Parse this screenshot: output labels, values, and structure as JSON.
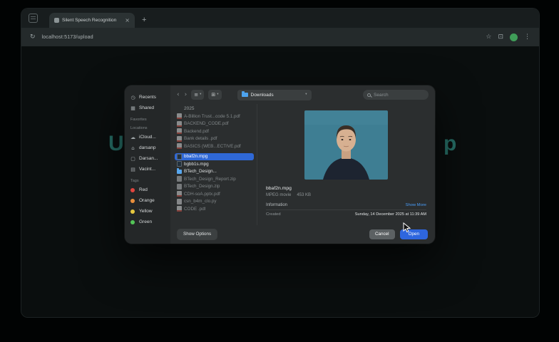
{
  "browser": {
    "tab": {
      "title": "Silent Speech Recognition",
      "close_label": "×"
    },
    "new_tab_label": "+",
    "nav": {
      "refresh_icon": "↻",
      "url": "localhost:5173/upload",
      "star_icon": "☆",
      "extensions_icon": "⊡",
      "menu_icon": "⋮"
    }
  },
  "page": {
    "heading_left": "U",
    "heading_right": "p"
  },
  "dialog": {
    "toolbar": {
      "back_icon": "‹",
      "forward_icon": "›",
      "view_icon": "≡",
      "group_icon": "⊞",
      "caret_icon": "▾",
      "location_label": "Downloads",
      "search_placeholder": "Search"
    },
    "sidebar": {
      "items": [
        {
          "label": "Recents",
          "icon": "clock-icon",
          "glyph": "◷"
        },
        {
          "label": "Shared",
          "icon": "shared-folder-icon",
          "glyph": "▦"
        }
      ],
      "favorites_title": "Favorites",
      "locations_title": "Locations",
      "locations": [
        {
          "label": "iCloud...",
          "icon": "cloud-icon",
          "glyph": "☁"
        },
        {
          "label": "darsanp",
          "icon": "home-icon",
          "glyph": "⌂"
        },
        {
          "label": "Darsan...",
          "icon": "display-icon",
          "glyph": "▢"
        },
        {
          "label": "Vacint...",
          "icon": "disk-icon",
          "glyph": "▤"
        }
      ],
      "tags_title": "Tags",
      "tags": [
        {
          "label": "Red",
          "color": "#e0453f"
        },
        {
          "label": "Orange",
          "color": "#e98f3c"
        },
        {
          "label": "Yellow",
          "color": "#e6c83f"
        },
        {
          "label": "Green",
          "color": "#53c457"
        }
      ]
    },
    "files": {
      "group_label": "2025",
      "items": [
        {
          "name": "A-Billion Trust...code 5.1.pdf",
          "kind": "pdf",
          "dim": true
        },
        {
          "name": "BACKEND_CODE.pdf",
          "kind": "pdf",
          "dim": true
        },
        {
          "name": "Backend.pdf",
          "kind": "pdf",
          "dim": true
        },
        {
          "name": "Bank details .pdf",
          "kind": "pdf",
          "dim": true
        },
        {
          "name": "BASICS (WEB...ECTIVE.pdf",
          "kind": "pdf",
          "dim": true
        },
        {
          "name": "bbaf2n.mpg",
          "kind": "movie",
          "selected": true
        },
        {
          "name": "bgbb1s.mpg",
          "kind": "movie"
        },
        {
          "name": "BTech_Design...",
          "kind": "folder"
        },
        {
          "name": "BTech_Design_Report.zip",
          "kind": "zip",
          "dim": true
        },
        {
          "name": "BTech_Design.zip",
          "kind": "zip",
          "dim": true
        },
        {
          "name": "CDH-soA.pptx.pdf",
          "kind": "pdf",
          "dim": true
        },
        {
          "name": "csn_b4m_clo.py",
          "kind": "code",
          "dim": true
        },
        {
          "name": "CODE .pdf",
          "kind": "pdf",
          "dim": true
        }
      ]
    },
    "preview": {
      "filename": "bbaf2n.mpg",
      "file_type": "MPEG movie",
      "file_size": "453 KB",
      "information_label": "Information",
      "show_more_label": "Show More",
      "created_label": "Created",
      "created_value": "Sunday, 14 December 2025 at 11:39 AM"
    },
    "footer": {
      "options_label": "Show Options",
      "cancel_label": "Cancel",
      "open_label": "Open"
    }
  },
  "colors": {
    "accent_blue": "#2e66de",
    "selection_blue": "#2f68d6",
    "link_blue": "#4a9df8",
    "heading_teal": "#266e66"
  }
}
